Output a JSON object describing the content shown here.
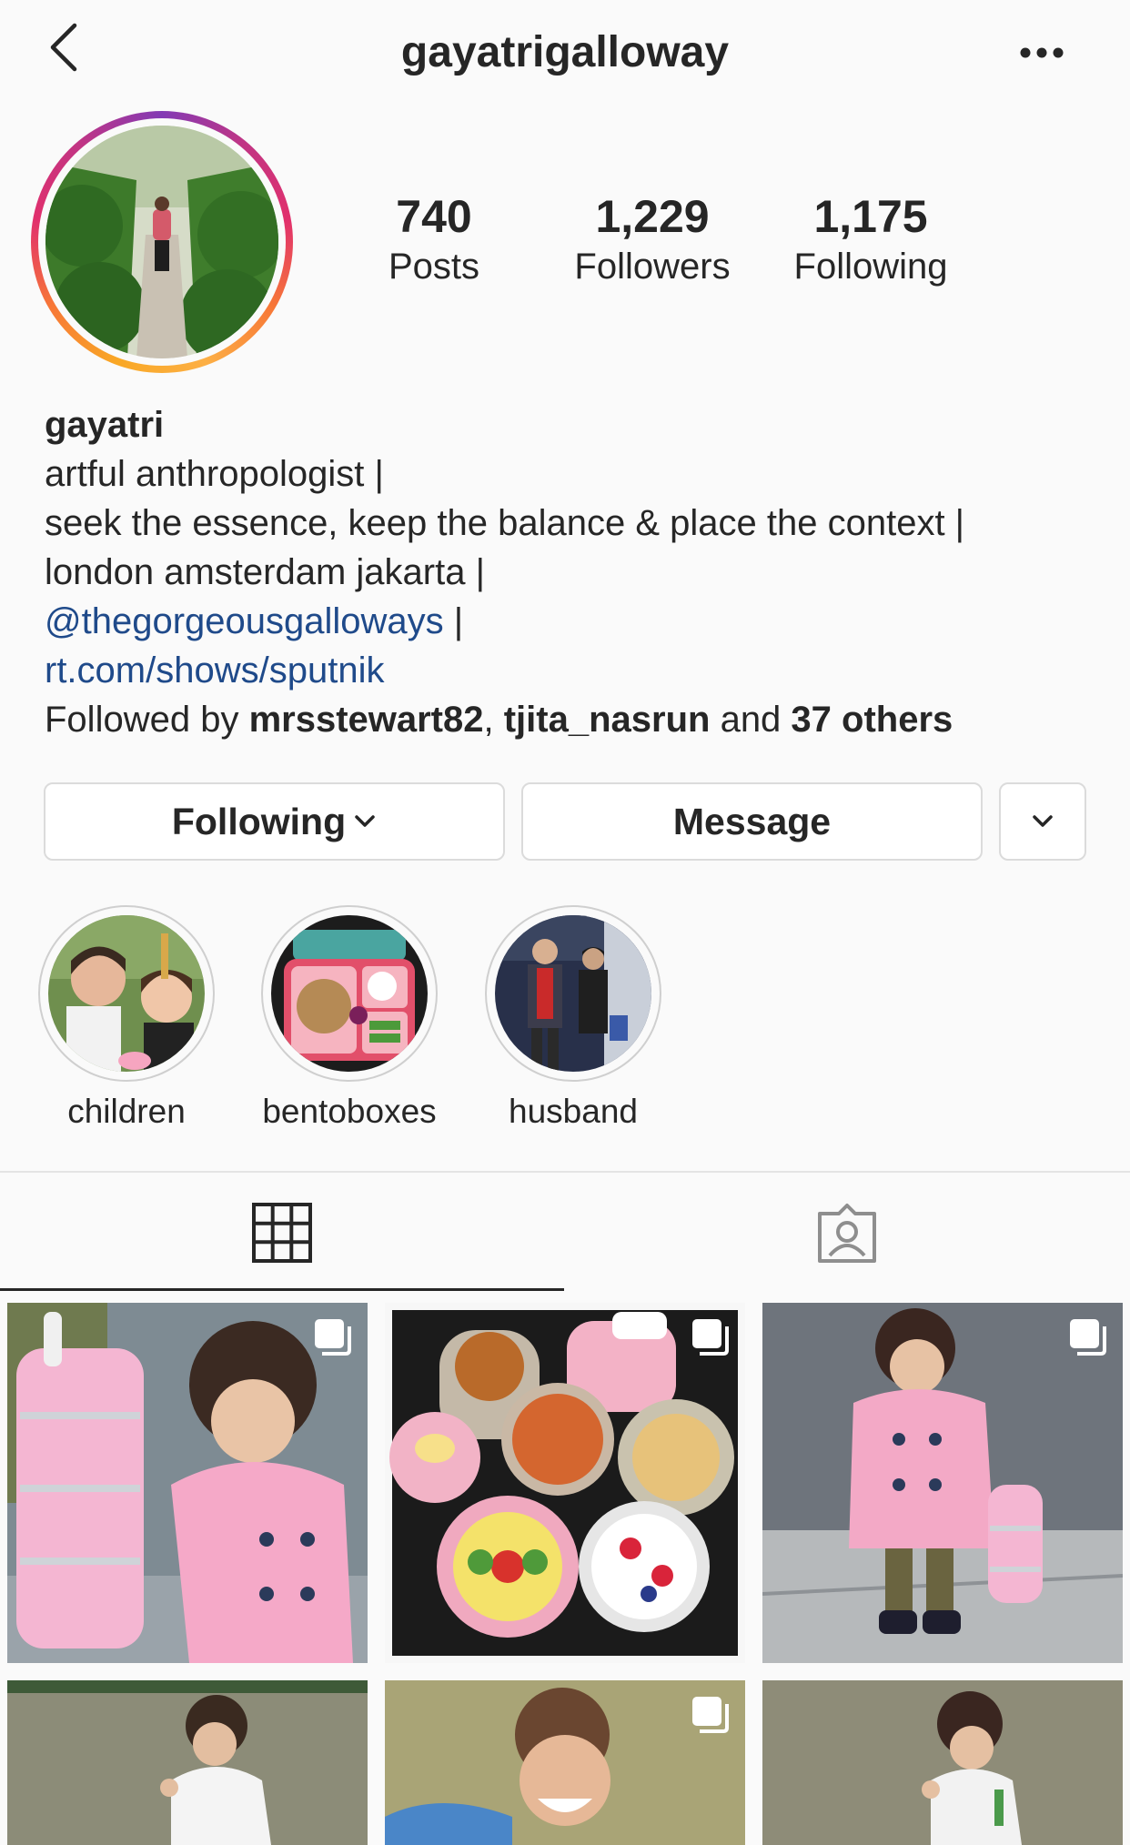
{
  "header": {
    "username": "gayatrigalloway",
    "back_icon": "chevron-left-icon",
    "more_icon": "ellipsis-icon"
  },
  "stats": {
    "posts": {
      "count": "740",
      "label": "Posts"
    },
    "followers": {
      "count": "1,229",
      "label": "Followers"
    },
    "following": {
      "count": "1,175",
      "label": "Following"
    }
  },
  "bio": {
    "name": "gayatri",
    "line1": "artful anthropologist |",
    "line2": "seek the essence, keep the balance & place the context |",
    "line3": "london amsterdam jakarta |",
    "mention": "@thegorgeousgalloways",
    "mention_suffix": " |",
    "url": "rt.com/shows/sputnik",
    "followed_prefix": "Followed by ",
    "followed_user1": "mrsstewart82",
    "followed_sep": ", ",
    "followed_user2": "tjita_nasrun",
    "followed_and": " and ",
    "followed_others": "37 others"
  },
  "actions": {
    "following_label": "Following",
    "message_label": "Message"
  },
  "highlights": [
    {
      "label": "children"
    },
    {
      "label": "bentoboxes"
    },
    {
      "label": "husband"
    }
  ],
  "tabs": [
    {
      "icon": "grid-icon",
      "active": true
    },
    {
      "icon": "tagged-icon",
      "active": false
    }
  ],
  "colors": {
    "link": "#1f4a8a",
    "text": "#262626",
    "border": "#dbdbdb",
    "background": "#fafafa"
  }
}
